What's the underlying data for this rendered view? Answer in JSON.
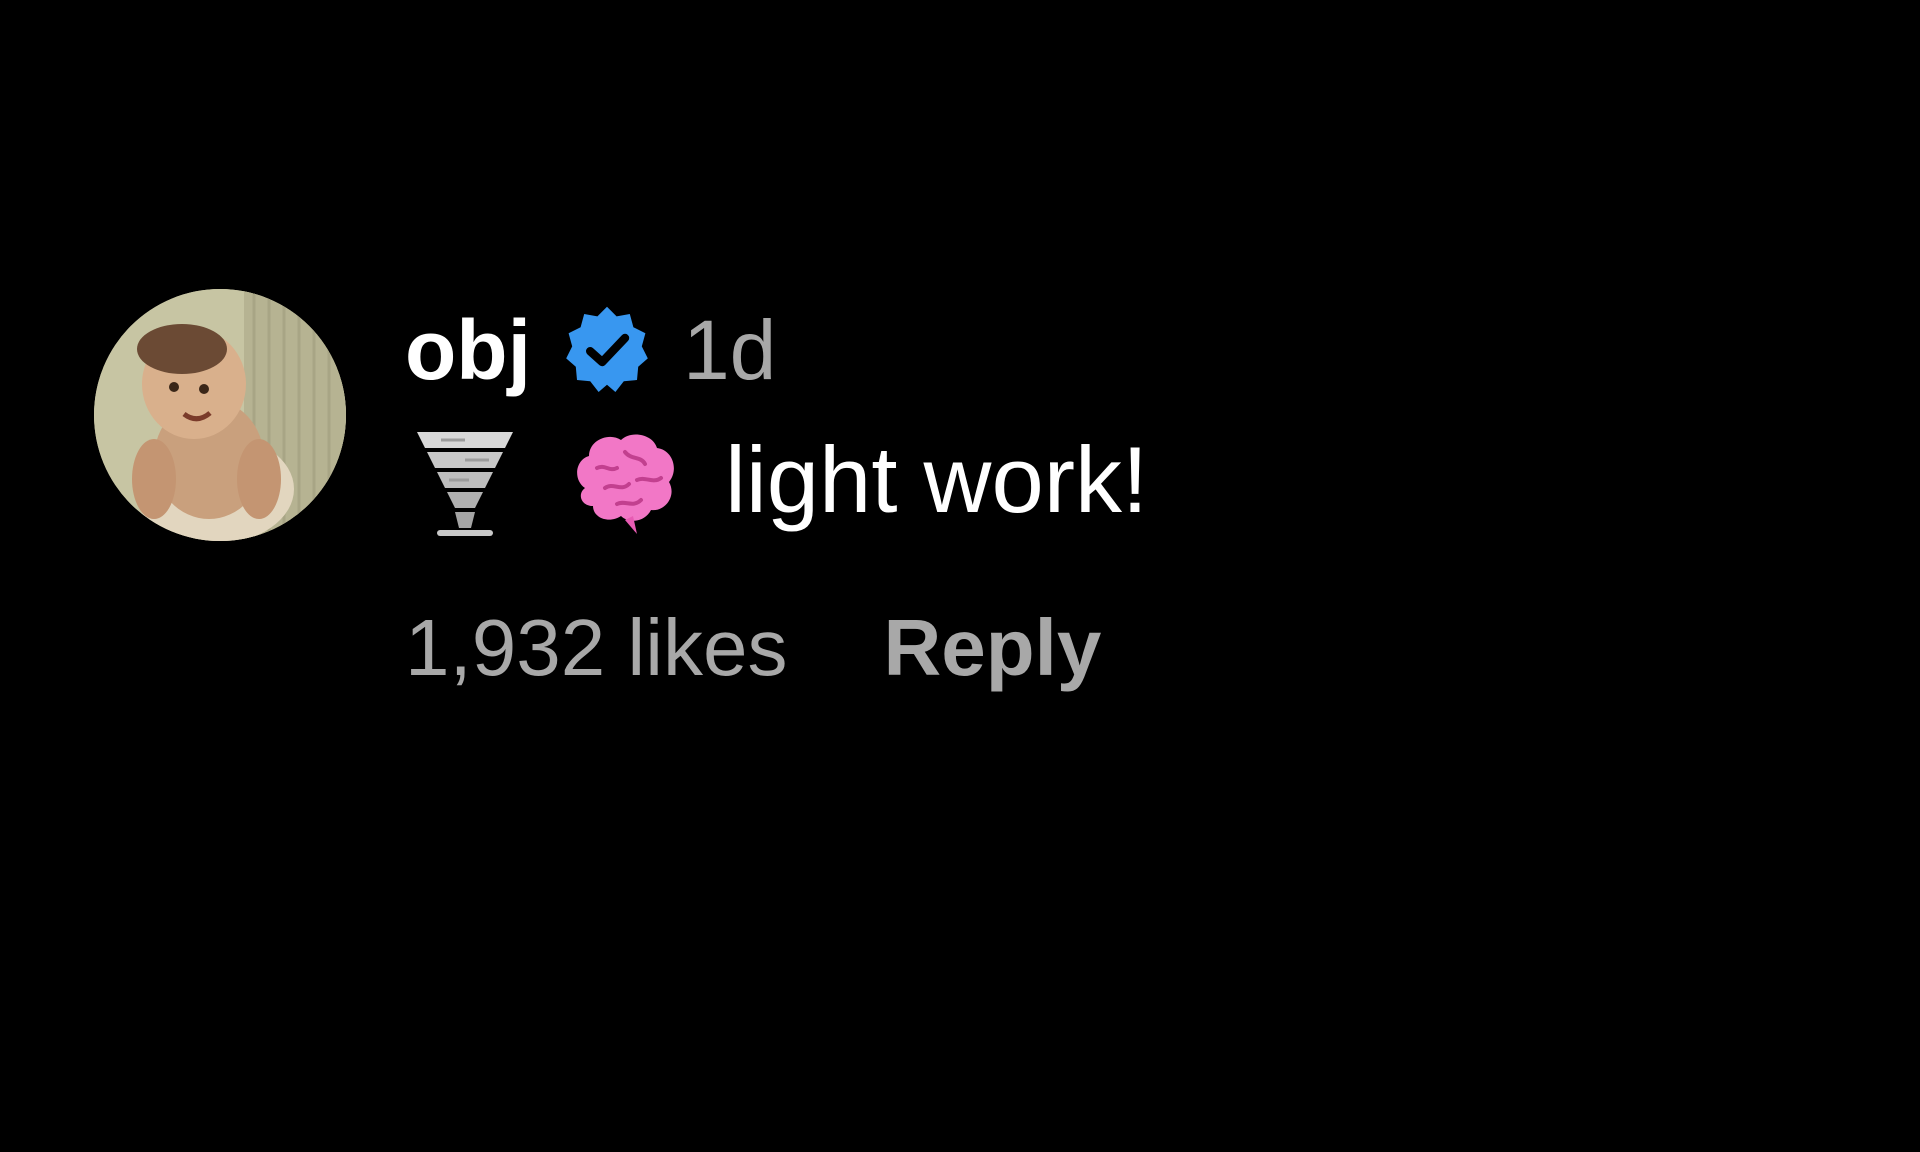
{
  "comment": {
    "avatar_icon": "avatar-photo",
    "username": "obj",
    "verified_icon": "verified-badge-icon",
    "verified_color": "#3897F0",
    "timestamp": "1d",
    "emojis": [
      "tornado-icon",
      "brain-icon"
    ],
    "text": "light work!",
    "likes": "1,932 likes",
    "reply_label": "Reply"
  }
}
